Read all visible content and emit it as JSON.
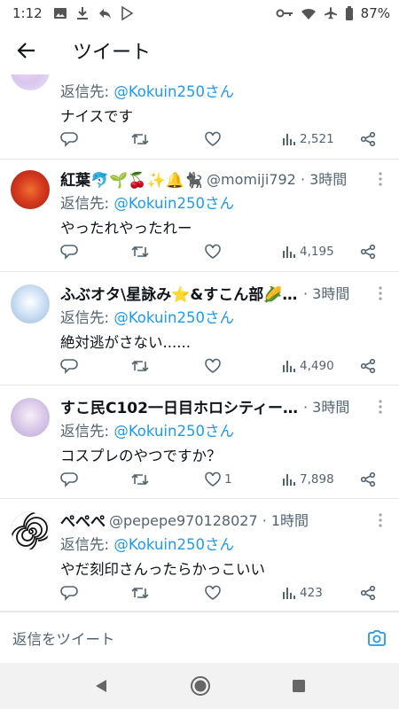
{
  "status_bar": {
    "time": "1:12",
    "battery": "87%",
    "left_icons": [
      "image-icon",
      "download-icon",
      "reply-icon",
      "play-store-icon"
    ],
    "right_icons": [
      "vpn-key-icon",
      "wifi-icon",
      "airplane-icon",
      "battery-icon"
    ]
  },
  "app_bar": {
    "title": "ツイート"
  },
  "tweets": [
    {
      "name": "",
      "handle": "",
      "reply_prefix": "返信先: ",
      "reply_handle": "@Kokuin250さん",
      "text": "ナイスです",
      "replies": "",
      "retweets": "",
      "likes": "",
      "views": "2,521"
    },
    {
      "name": "紅葉🐬🌱🍒✨🔔🐈‍⬛",
      "handle": "@momiji792 · 3時間",
      "reply_prefix": "返信先: ",
      "reply_handle": "@Kokuin250さん",
      "text": "やったれやったれー",
      "replies": "",
      "retweets": "",
      "likes": "",
      "views": "4,195"
    },
    {
      "name": "ふぶオタ\\星詠み⭐&すこん部🌽🦊",
      "handle": "· 3時間",
      "reply_prefix": "返信先: ",
      "reply_handle": "@Kokuin250さん",
      "text": "絶対逃がさない......",
      "replies": "",
      "retweets": "",
      "likes": "",
      "views": "4,490"
    },
    {
      "name": "すこ民C102一日目ホロシティー2...",
      "handle": "· 3時間",
      "reply_prefix": "返信先: ",
      "reply_handle": "@Kokuin250さん",
      "text": "コスプレのやつですか？",
      "replies": "",
      "retweets": "",
      "likes": "1",
      "views": "7,898"
    },
    {
      "name": "ぺぺぺ",
      "handle": "@pepepe970128027 · 1時間",
      "reply_prefix": "返信先: ",
      "reply_handle": "@Kokuin250さん",
      "text": "やだ刻印さんったらかっこいい",
      "replies": "",
      "retweets": "",
      "likes": "",
      "views": "423"
    }
  ],
  "composer": {
    "placeholder": "返信をツイート"
  },
  "colors": {
    "accent": "#1d9bf0",
    "muted": "#536471",
    "text": "#0f1419"
  }
}
